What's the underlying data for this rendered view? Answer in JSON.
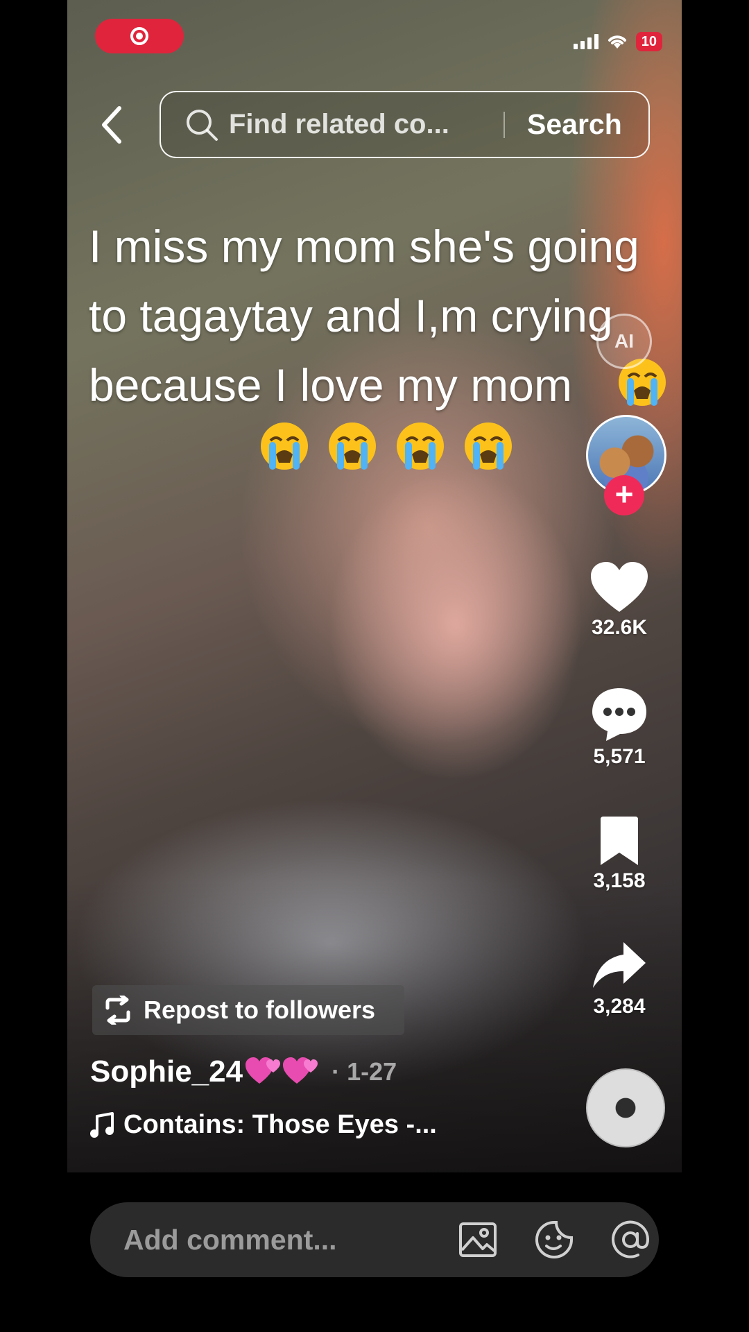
{
  "status_bar": {
    "battery": "10"
  },
  "search": {
    "placeholder": "Find related co...",
    "button": "Search"
  },
  "caption": {
    "lines": [
      "I miss my mom she's going",
      "to tagaytay and I,m crying",
      "because I love my mom"
    ]
  },
  "ai_badge": "AI",
  "actions": {
    "likes": "32.6K",
    "comments": "5,571",
    "saves": "3,158",
    "shares": "3,284"
  },
  "repost": {
    "label": "Repost to followers"
  },
  "post": {
    "author": "Sophie_24",
    "date": "· 1-27",
    "sound": "Contains: Those Eyes -..."
  },
  "comment": {
    "placeholder": "Add comment..."
  },
  "colors": {
    "accent_red": "#e0243c",
    "follow_pink": "#f02a58"
  }
}
